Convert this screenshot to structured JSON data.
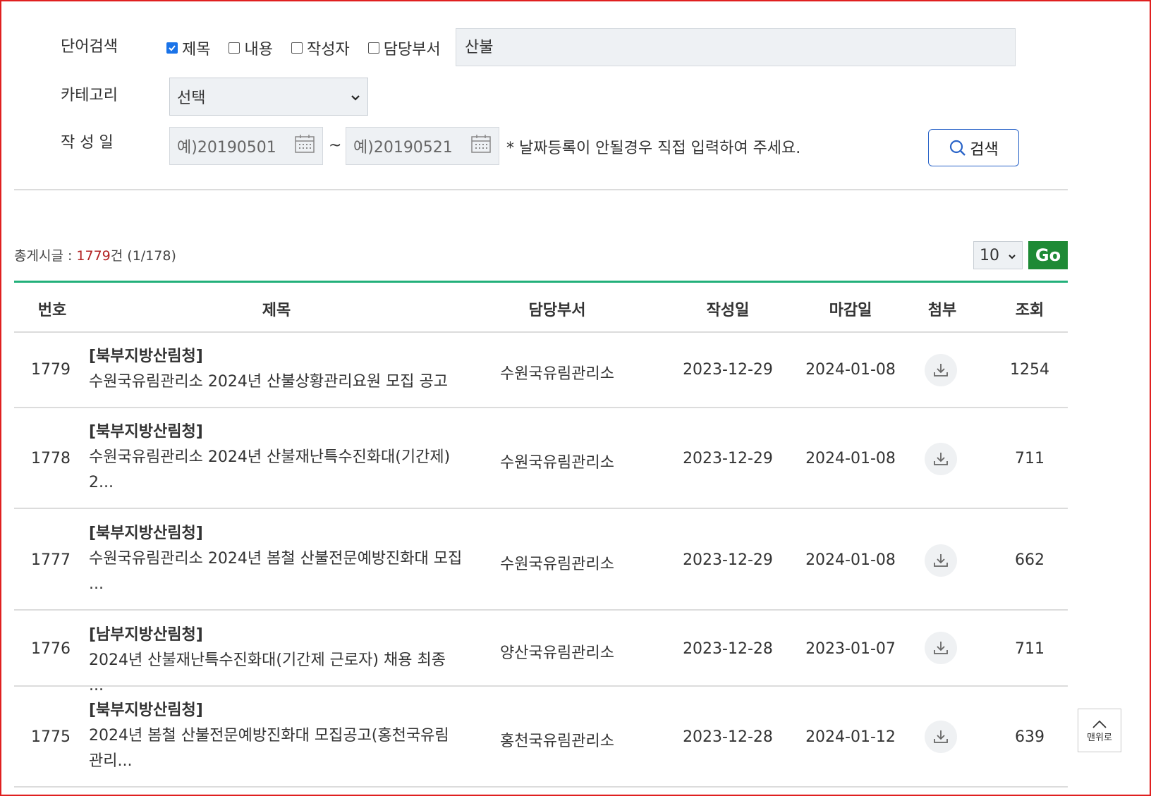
{
  "search": {
    "word_label": "단어검색",
    "options": [
      {
        "label": "제목",
        "checked": true
      },
      {
        "label": "내용",
        "checked": false
      },
      {
        "label": "작성자",
        "checked": false
      },
      {
        "label": "담당부서",
        "checked": false
      }
    ],
    "query": "산불",
    "category_label": "카테고리",
    "category_value": "선택",
    "date_label": "작 성 일",
    "date_from_placeholder": "예)20190501",
    "date_sep": "~",
    "date_to_placeholder": "예)20190521",
    "date_note": "* 날짜등록이 안될경우 직접 입력하여 주세요.",
    "search_button": "검색"
  },
  "summary": {
    "prefix": "총게시글 : ",
    "count": "1779",
    "suffix": "건 (1/178)",
    "page_size": "10",
    "go_label": "Go"
  },
  "table": {
    "headers": [
      "번호",
      "제목",
      "담당부서",
      "작성일",
      "마감일",
      "첨부",
      "조회"
    ],
    "rows": [
      {
        "no": "1779",
        "org": "[북부지방산림청]",
        "title": "수원국유림관리소 2024년 산불상황관리요원 모집 공고",
        "dept": "수원국유림관리소",
        "created": "2023-12-29",
        "deadline": "2024-01-08",
        "views": "1254"
      },
      {
        "no": "1778",
        "org": "[북부지방산림청]",
        "title": "수원국유림관리소 2024년 산불재난특수진화대(기간제) 2...",
        "dept": "수원국유림관리소",
        "created": "2023-12-29",
        "deadline": "2024-01-08",
        "views": "711"
      },
      {
        "no": "1777",
        "org": "[북부지방산림청]",
        "title": "수원국유림관리소 2024년 봄철 산불전문예방진화대 모집 ...",
        "dept": "수원국유림관리소",
        "created": "2023-12-29",
        "deadline": "2024-01-08",
        "views": "662"
      },
      {
        "no": "1776",
        "org": "[남부지방산림청]",
        "title": "2024년 산불재난특수진화대(기간제 근로자) 채용 최종 ...",
        "dept": "양산국유림관리소",
        "created": "2023-12-28",
        "deadline": "2023-01-07",
        "views": "711"
      },
      {
        "no": "1775",
        "org": "[북부지방산림청]",
        "title": "2024년 봄철 산불전문예방진화대 모집공고(홍천국유림관리...",
        "dept": "홍천국유림관리소",
        "created": "2023-12-28",
        "deadline": "2024-01-12",
        "views": "639"
      }
    ]
  },
  "top_button": "맨위로",
  "colors": {
    "accent_green": "#1e8a35",
    "table_line": "#22b07a",
    "count_red": "#b22222",
    "btn_border": "#2a64c8"
  }
}
